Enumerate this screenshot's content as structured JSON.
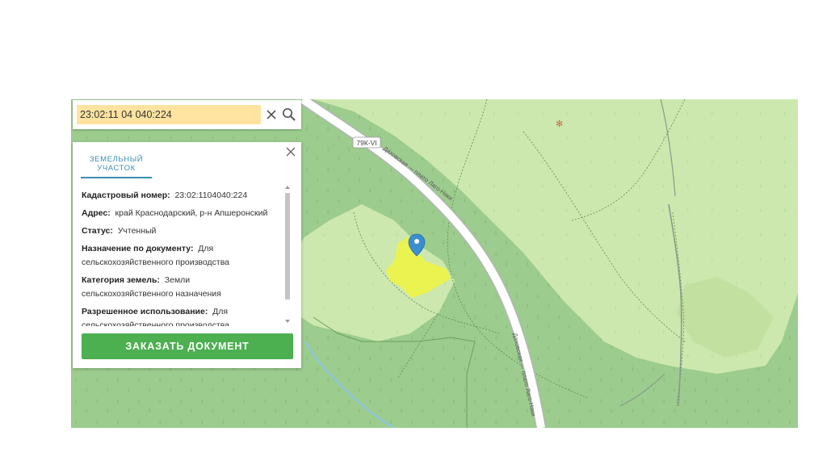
{
  "search": {
    "value": "23:02:11 04 040:224"
  },
  "panel": {
    "tab_label": "ЗЕМЕЛЬНЫЙ УЧАСТОК",
    "rows": [
      {
        "label": "Кадастровый номер:",
        "value": "23:02:1104040:224"
      },
      {
        "label": "Адрес:",
        "value": "край Краснодарский, р-н Апшеронский"
      },
      {
        "label": "Статус:",
        "value": "Учтенный"
      },
      {
        "label": "Назначение по документу:",
        "value": "Для сельскохозяйственного производства"
      },
      {
        "label": "Категория земель:",
        "value": "Земли сельскохозяйственного назначения"
      },
      {
        "label": "Разрешенное использование:",
        "value": "Для сельскохозяйственного производства"
      }
    ],
    "order_button": "ЗАКАЗАТЬ ДОКУМЕНТ"
  },
  "map": {
    "road_badge": "79К-VI",
    "road_label_1": "Даховская — плато Лаго-Наки",
    "road_label_2": "Даховская — плато Лаго-Наки",
    "colors": {
      "forest": "#9ccc8e",
      "meadow": "#cde8ae",
      "parcel": "#eef540",
      "pin": "#3b8fd0",
      "button": "#4caf50",
      "search_highlight": "#ffe3a0"
    }
  }
}
